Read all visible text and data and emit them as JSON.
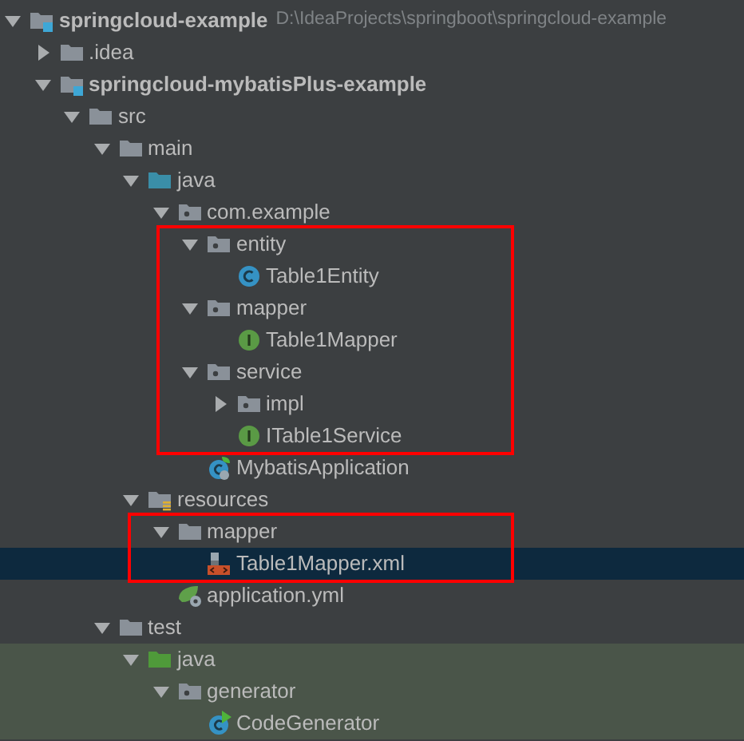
{
  "project_tree": [
    {
      "label": "springcloud-example",
      "path": "D:\\IdeaProjects\\springboot\\springcloud-example",
      "kind": "module",
      "expanded": true,
      "selected": false,
      "children": [
        {
          "label": ".idea",
          "kind": "folder",
          "expanded": false,
          "selected": false
        },
        {
          "label": "springcloud-mybatisPlus-example",
          "kind": "module",
          "expanded": true,
          "selected": false,
          "children": [
            {
              "label": "src",
              "kind": "folder",
              "expanded": true,
              "selected": false,
              "children": [
                {
                  "label": "main",
                  "kind": "folder",
                  "expanded": true,
                  "selected": false,
                  "children": [
                    {
                      "label": "java",
                      "kind": "source-folder",
                      "expanded": true,
                      "selected": false,
                      "children": [
                        {
                          "label": "com.example",
                          "kind": "package",
                          "expanded": true,
                          "selected": false,
                          "children": [
                            {
                              "label": "entity",
                              "kind": "package",
                              "expanded": true,
                              "selected": false,
                              "boxed": true,
                              "children": [
                                {
                                  "label": "Table1Entity",
                                  "kind": "class",
                                  "selected": false
                                }
                              ]
                            },
                            {
                              "label": "mapper",
                              "kind": "package",
                              "expanded": true,
                              "selected": false,
                              "boxed": true,
                              "children": [
                                {
                                  "label": "Table1Mapper",
                                  "kind": "interface",
                                  "selected": false
                                }
                              ]
                            },
                            {
                              "label": "service",
                              "kind": "package",
                              "expanded": true,
                              "selected": false,
                              "boxed": true,
                              "children": [
                                {
                                  "label": "impl",
                                  "kind": "package",
                                  "expanded": false,
                                  "selected": false
                                },
                                {
                                  "label": "ITable1Service",
                                  "kind": "interface",
                                  "selected": false
                                }
                              ]
                            },
                            {
                              "label": "MybatisApplication",
                              "kind": "boot-class",
                              "selected": false
                            }
                          ]
                        }
                      ]
                    },
                    {
                      "label": "resources",
                      "kind": "resources-folder",
                      "expanded": true,
                      "selected": false,
                      "children": [
                        {
                          "label": "mapper",
                          "kind": "folder",
                          "expanded": true,
                          "selected": false,
                          "boxed": true,
                          "children": [
                            {
                              "label": "Table1Mapper.xml",
                              "kind": "xml-file",
                              "selected": true
                            }
                          ]
                        },
                        {
                          "label": "application.yml",
                          "kind": "yml-file",
                          "selected": false
                        }
                      ]
                    }
                  ]
                },
                {
                  "label": "test",
                  "kind": "folder",
                  "expanded": true,
                  "selected": false,
                  "children": [
                    {
                      "label": "java",
                      "kind": "test-folder",
                      "expanded": true,
                      "selected": false,
                      "tinted": true,
                      "children": [
                        {
                          "label": "generator",
                          "kind": "package",
                          "expanded": true,
                          "selected": false,
                          "tinted": true,
                          "children": [
                            {
                              "label": "CodeGenerator",
                              "kind": "test-class",
                              "selected": false,
                              "tinted": true
                            }
                          ]
                        }
                      ]
                    }
                  ]
                }
              ]
            }
          ]
        }
      ]
    }
  ]
}
